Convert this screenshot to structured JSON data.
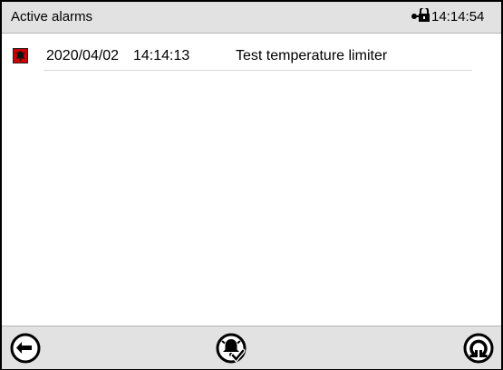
{
  "header": {
    "title": "Active alarms",
    "clock": "14:14:54",
    "lock_icon": "lock-key-icon"
  },
  "alarms": [
    {
      "icon": "alarm-bell-icon",
      "date": "2020/04/02",
      "time": "14:14:13",
      "message": "Test temperature limiter"
    }
  ],
  "footer": {
    "back_icon": "back-arrow-icon",
    "silence_icon": "alarm-acknowledge-icon",
    "refresh_icon": "refresh-icon"
  },
  "colors": {
    "bar_background": "#e2e2e2",
    "alarm_red": "#cc0000"
  }
}
